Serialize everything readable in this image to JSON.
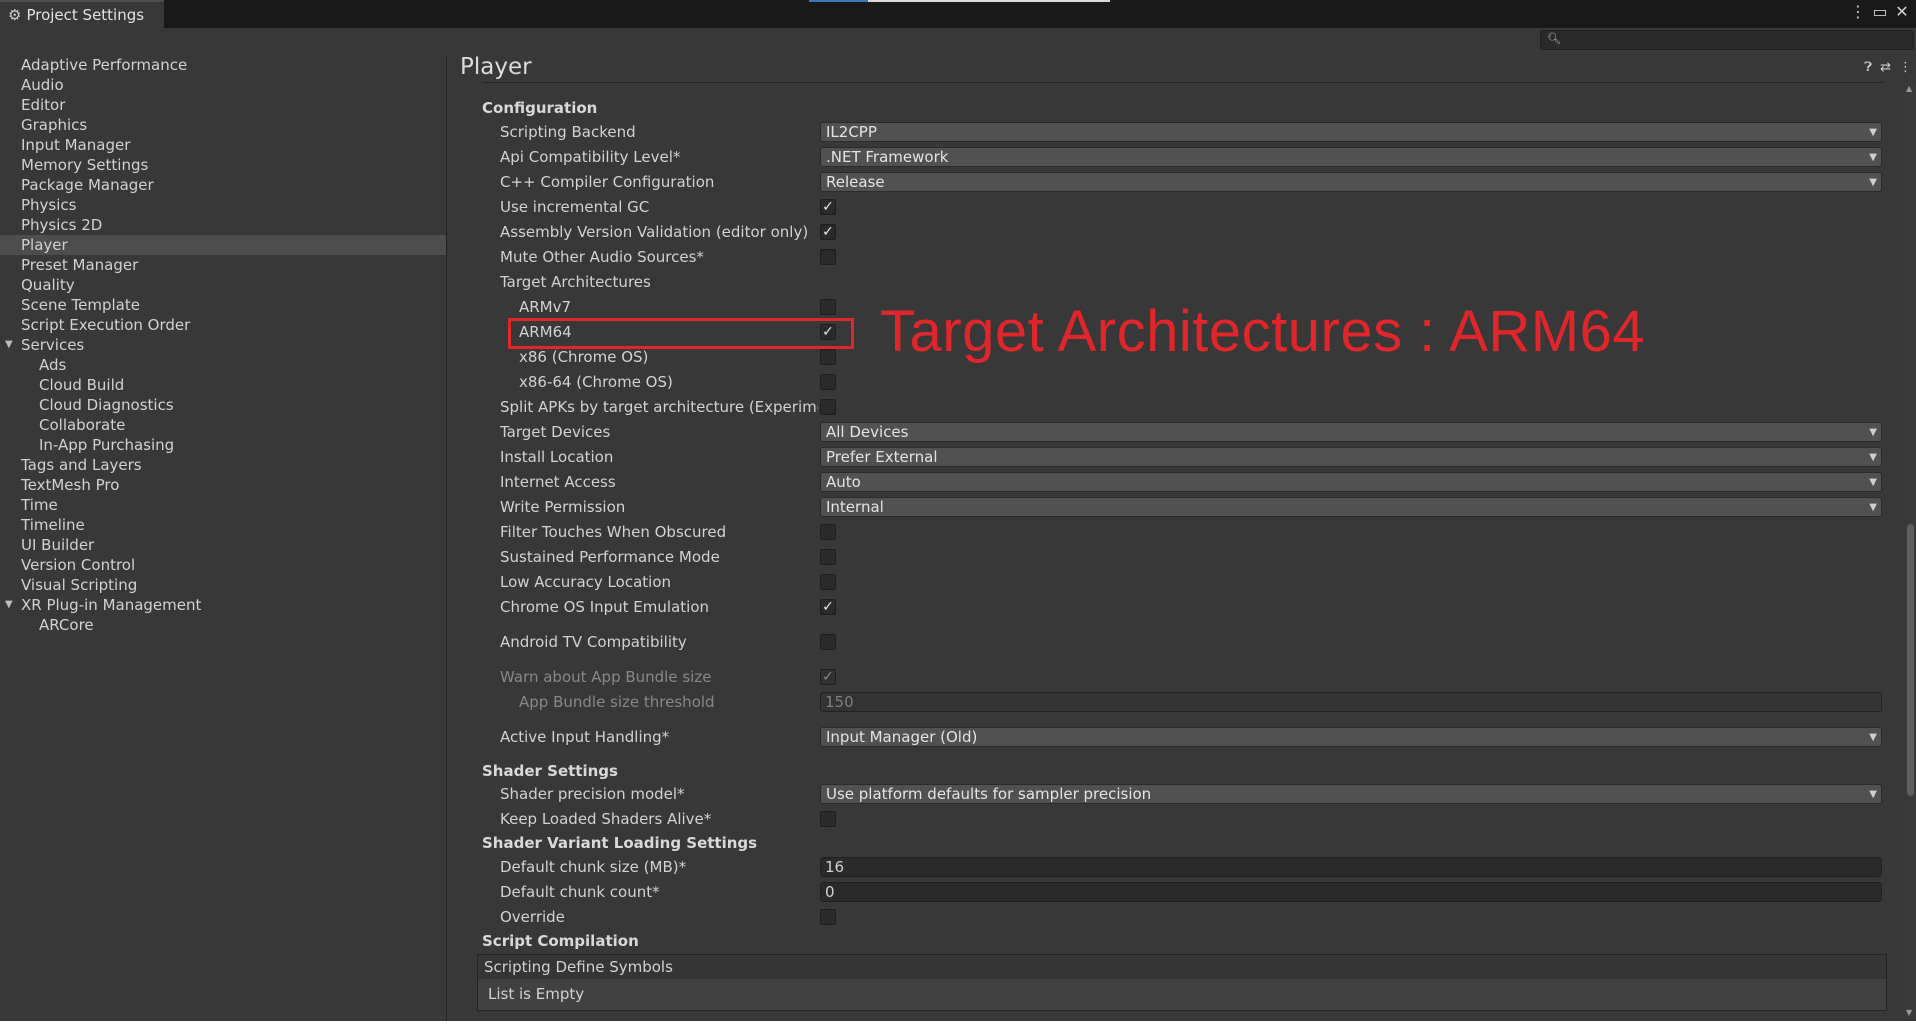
{
  "window": {
    "tab_title": "Project Settings"
  },
  "sidebar": {
    "items": [
      {
        "label": "Adaptive Performance"
      },
      {
        "label": "Audio"
      },
      {
        "label": "Editor"
      },
      {
        "label": "Graphics"
      },
      {
        "label": "Input Manager"
      },
      {
        "label": "Memory Settings"
      },
      {
        "label": "Package Manager"
      },
      {
        "label": "Physics"
      },
      {
        "label": "Physics 2D"
      },
      {
        "label": "Player",
        "selected": true
      },
      {
        "label": "Preset Manager"
      },
      {
        "label": "Quality"
      },
      {
        "label": "Scene Template"
      },
      {
        "label": "Script Execution Order"
      },
      {
        "label": "Services",
        "expanded": true
      },
      {
        "label": "Ads",
        "child": true
      },
      {
        "label": "Cloud Build",
        "child": true
      },
      {
        "label": "Cloud Diagnostics",
        "child": true
      },
      {
        "label": "Collaborate",
        "child": true
      },
      {
        "label": "In-App Purchasing",
        "child": true
      },
      {
        "label": "Tags and Layers"
      },
      {
        "label": "TextMesh Pro"
      },
      {
        "label": "Time"
      },
      {
        "label": "Timeline"
      },
      {
        "label": "UI Builder"
      },
      {
        "label": "Version Control"
      },
      {
        "label": "Visual Scripting"
      },
      {
        "label": "XR Plug-in Management",
        "expanded": true
      },
      {
        "label": "ARCore",
        "child": true
      }
    ]
  },
  "main": {
    "title": "Player",
    "configuration": {
      "header": "Configuration",
      "scripting_backend": {
        "label": "Scripting Backend",
        "value": "IL2CPP"
      },
      "api_compat": {
        "label": "Api Compatibility Level*",
        "value": ".NET Framework"
      },
      "cpp_compiler": {
        "label": "C++ Compiler Configuration",
        "value": "Release"
      },
      "incremental_gc": {
        "label": "Use incremental GC",
        "checked": true
      },
      "assembly_validation": {
        "label": "Assembly Version Validation (editor only)",
        "checked": true
      },
      "mute_audio": {
        "label": "Mute Other Audio Sources*",
        "checked": false
      },
      "target_arch": {
        "label": "Target Architectures"
      },
      "armv7": {
        "label": "ARMv7",
        "checked": false
      },
      "arm64": {
        "label": "ARM64",
        "checked": true
      },
      "x86": {
        "label": "x86 (Chrome OS)",
        "checked": false
      },
      "x86_64": {
        "label": "x86-64 (Chrome OS)",
        "checked": false
      },
      "split_apks": {
        "label": "Split APKs by target architecture (Experimen",
        "checked": false
      },
      "target_devices": {
        "label": "Target Devices",
        "value": "All Devices"
      },
      "install_location": {
        "label": "Install Location",
        "value": "Prefer External"
      },
      "internet_access": {
        "label": "Internet Access",
        "value": "Auto"
      },
      "write_permission": {
        "label": "Write Permission",
        "value": "Internal"
      },
      "filter_touches": {
        "label": "Filter Touches When Obscured",
        "checked": false
      },
      "sustained_perf": {
        "label": "Sustained Performance Mode",
        "checked": false
      },
      "low_accuracy": {
        "label": "Low Accuracy Location",
        "checked": false
      },
      "chrome_input": {
        "label": "Chrome OS Input Emulation",
        "checked": true
      },
      "android_tv": {
        "label": "Android TV Compatibility",
        "checked": false
      },
      "warn_bundle": {
        "label": "Warn about App Bundle size",
        "checked": true
      },
      "bundle_threshold": {
        "label": "App Bundle size threshold",
        "value": "150"
      },
      "active_input": {
        "label": "Active Input Handling*",
        "value": "Input Manager (Old)"
      }
    },
    "shader_settings": {
      "header": "Shader Settings",
      "precision_model": {
        "label": "Shader precision model*",
        "value": "Use platform defaults for sampler precision"
      },
      "keep_loaded": {
        "label": "Keep Loaded Shaders Alive*",
        "checked": false
      }
    },
    "shader_variant": {
      "header": "Shader Variant Loading Settings",
      "chunk_size": {
        "label": "Default chunk size (MB)*",
        "value": "16"
      },
      "chunk_count": {
        "label": "Default chunk count*",
        "value": "0"
      },
      "override": {
        "label": "Override",
        "checked": false
      }
    },
    "script_compilation": {
      "header": "Script Compilation",
      "define_symbols": "Scripting Define Symbols",
      "list_empty": "List is Empty"
    }
  },
  "annotation": {
    "text": "Target Architectures : ARM64",
    "color": "#e1262b"
  },
  "colors": {
    "window_bg": "#383838",
    "titlebar_bg": "#191919",
    "selected_bg": "#4d4d4d",
    "dropdown_bg": "#515151",
    "field_bg": "#2a2a2a",
    "accent_blue": "#3a79bb"
  },
  "icons": {
    "tab": "gear-icon",
    "search": "search-icon",
    "help": "help-icon",
    "presets": "sliders-icon",
    "more": "kebab-menu-icon",
    "maximize": "maximize-icon",
    "close": "close-icon"
  }
}
